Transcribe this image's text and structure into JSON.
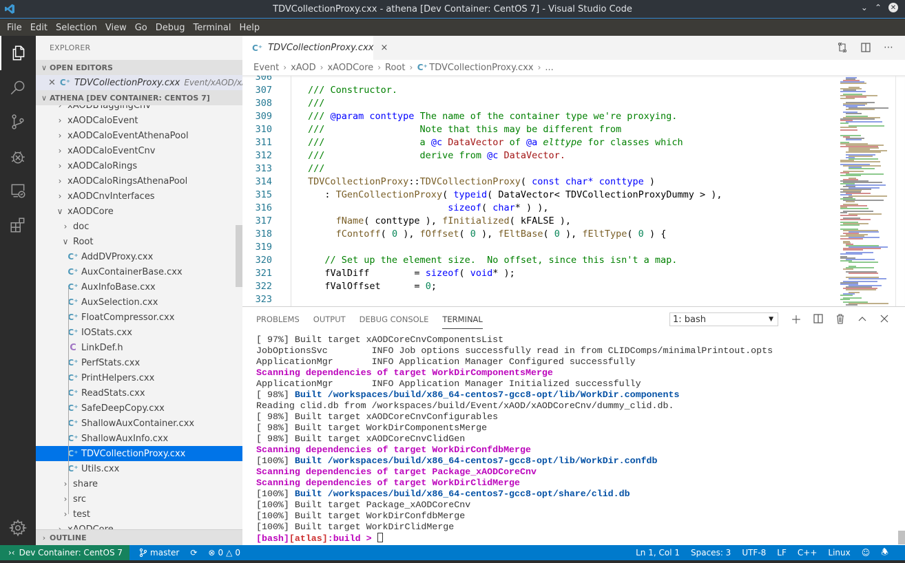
{
  "window": {
    "title": "TDVCollectionProxy.cxx - athena [Dev Container: CentOS 7] - Visual Studio Code",
    "controls": [
      "minimize",
      "maximize",
      "close"
    ]
  },
  "menu": [
    "File",
    "Edit",
    "Selection",
    "View",
    "Go",
    "Debug",
    "Terminal",
    "Help"
  ],
  "activity_bar": [
    {
      "icon": "files-icon",
      "active": true
    },
    {
      "icon": "search-icon"
    },
    {
      "icon": "source-control-icon"
    },
    {
      "icon": "debug-icon"
    },
    {
      "icon": "remote-explorer-icon"
    },
    {
      "icon": "extensions-icon"
    },
    {
      "icon": "gear-icon"
    }
  ],
  "sidebar": {
    "title": "EXPLORER",
    "open_editors": {
      "label": "OPEN EDITORS",
      "items": [
        {
          "name": "TDVCollectionProxy.cxx",
          "path": "Event/xAOD/xAO..."
        }
      ]
    },
    "workspace_label": "ATHENA [DEV CONTAINER: CENTOS 7]",
    "tree": [
      {
        "label": "xAODBTaggingCnv",
        "type": "folder",
        "expanded": false,
        "depth": 1
      },
      {
        "label": "xAODCaloEvent",
        "type": "folder",
        "expanded": false,
        "depth": 1
      },
      {
        "label": "xAODCaloEventAthenaPool",
        "type": "folder",
        "expanded": false,
        "depth": 1
      },
      {
        "label": "xAODCaloEventCnv",
        "type": "folder",
        "expanded": false,
        "depth": 1
      },
      {
        "label": "xAODCaloRings",
        "type": "folder",
        "expanded": false,
        "depth": 1
      },
      {
        "label": "xAODCaloRingsAthenaPool",
        "type": "folder",
        "expanded": false,
        "depth": 1
      },
      {
        "label": "xAODCnvInterfaces",
        "type": "folder",
        "expanded": false,
        "depth": 1
      },
      {
        "label": "xAODCore",
        "type": "folder",
        "expanded": true,
        "depth": 1
      },
      {
        "label": "doc",
        "type": "folder",
        "expanded": false,
        "depth": 2
      },
      {
        "label": "Root",
        "type": "folder",
        "expanded": true,
        "depth": 2
      },
      {
        "label": "AddDVProxy.cxx",
        "type": "cpp",
        "depth": 3
      },
      {
        "label": "AuxContainerBase.cxx",
        "type": "cpp",
        "depth": 3
      },
      {
        "label": "AuxInfoBase.cxx",
        "type": "cpp",
        "depth": 3
      },
      {
        "label": "AuxSelection.cxx",
        "type": "cpp",
        "depth": 3
      },
      {
        "label": "FloatCompressor.cxx",
        "type": "cpp",
        "depth": 3
      },
      {
        "label": "IOStats.cxx",
        "type": "cpp",
        "depth": 3
      },
      {
        "label": "LinkDef.h",
        "type": "h",
        "depth": 3
      },
      {
        "label": "PerfStats.cxx",
        "type": "cpp",
        "depth": 3
      },
      {
        "label": "PrintHelpers.cxx",
        "type": "cpp",
        "depth": 3
      },
      {
        "label": "ReadStats.cxx",
        "type": "cpp",
        "depth": 3
      },
      {
        "label": "SafeDeepCopy.cxx",
        "type": "cpp",
        "depth": 3
      },
      {
        "label": "ShallowAuxContainer.cxx",
        "type": "cpp",
        "depth": 3
      },
      {
        "label": "ShallowAuxInfo.cxx",
        "type": "cpp",
        "depth": 3
      },
      {
        "label": "TDVCollectionProxy.cxx",
        "type": "cpp",
        "depth": 3,
        "selected": true
      },
      {
        "label": "Utils.cxx",
        "type": "cpp",
        "depth": 3
      },
      {
        "label": "share",
        "type": "folder",
        "expanded": false,
        "depth": 2
      },
      {
        "label": "src",
        "type": "folder",
        "expanded": false,
        "depth": 2
      },
      {
        "label": "test",
        "type": "folder",
        "expanded": false,
        "depth": 2
      },
      {
        "label": "xAODCore",
        "type": "folder",
        "expanded": false,
        "depth": 1
      }
    ],
    "outline_label": "OUTLINE"
  },
  "editor": {
    "tab": {
      "name": "TDVCollectionProxy.cxx",
      "close": "×"
    },
    "breadcrumb": [
      "Event",
      "xAOD",
      "xAODCore",
      "Root",
      "TDVCollectionProxy.cxx",
      "..."
    ],
    "lines": [
      {
        "n": "306",
        "tokens": []
      },
      {
        "n": "307",
        "tokens": [
          {
            "t": "/// Constructor.",
            "c": "c-com"
          }
        ]
      },
      {
        "n": "308",
        "tokens": [
          {
            "t": "///",
            "c": "c-com"
          }
        ]
      },
      {
        "n": "309",
        "tokens": [
          {
            "t": "/// ",
            "c": "c-com"
          },
          {
            "t": "@param conttype",
            "c": "c-doc"
          },
          {
            "t": " The name of the container type we're proxying.",
            "c": "c-com"
          }
        ]
      },
      {
        "n": "310",
        "tokens": [
          {
            "t": "///                 Note that this may be different from",
            "c": "c-com"
          }
        ]
      },
      {
        "n": "311",
        "tokens": [
          {
            "t": "///                 a ",
            "c": "c-com"
          },
          {
            "t": "@c",
            "c": "c-doc"
          },
          {
            "t": " DataVector",
            "c": "c-type"
          },
          {
            "t": " of ",
            "c": "c-com"
          },
          {
            "t": "@a",
            "c": "c-doc"
          },
          {
            "t": " elttype",
            "c": "c-com c-it"
          },
          {
            "t": " for classes which",
            "c": "c-com"
          }
        ]
      },
      {
        "n": "312",
        "tokens": [
          {
            "t": "///                 derive from ",
            "c": "c-com"
          },
          {
            "t": "@c",
            "c": "c-doc"
          },
          {
            "t": " DataVector.",
            "c": "c-type"
          }
        ]
      },
      {
        "n": "313",
        "tokens": [
          {
            "t": "///",
            "c": "c-com"
          }
        ]
      },
      {
        "n": "314",
        "tokens": [
          {
            "t": "TDVCollectionProxy",
            "c": "c-fn"
          },
          {
            "t": "::",
            "c": ""
          },
          {
            "t": "TDVCollectionProxy",
            "c": "c-fn"
          },
          {
            "t": "( ",
            "c": ""
          },
          {
            "t": "const char*",
            "c": "c-kw"
          },
          {
            "t": " ",
            "c": ""
          },
          {
            "t": "conttype",
            "c": "c-kw"
          },
          {
            "t": " )",
            "c": ""
          }
        ]
      },
      {
        "n": "315",
        "tokens": [
          {
            "t": "   : ",
            "c": ""
          },
          {
            "t": "TGenCollectionProxy",
            "c": "c-fn"
          },
          {
            "t": "( ",
            "c": ""
          },
          {
            "t": "typeid",
            "c": "c-kw"
          },
          {
            "t": "( DataVector< TDVCollectionProxyDummy > ),",
            "c": ""
          }
        ]
      },
      {
        "n": "316",
        "tokens": [
          {
            "t": "                         ",
            "c": ""
          },
          {
            "t": "sizeof",
            "c": "c-kw"
          },
          {
            "t": "( ",
            "c": ""
          },
          {
            "t": "char",
            "c": "c-kw"
          },
          {
            "t": "* ) ),",
            "c": ""
          }
        ]
      },
      {
        "n": "317",
        "tokens": [
          {
            "t": "     ",
            "c": ""
          },
          {
            "t": "fName",
            "c": "c-fn"
          },
          {
            "t": "( conttype ), ",
            "c": ""
          },
          {
            "t": "fInitialized",
            "c": "c-fn"
          },
          {
            "t": "( kFALSE ),",
            "c": ""
          }
        ]
      },
      {
        "n": "318",
        "tokens": [
          {
            "t": "     ",
            "c": ""
          },
          {
            "t": "fContoff",
            "c": "c-fn"
          },
          {
            "t": "( ",
            "c": ""
          },
          {
            "t": "0",
            "c": "c-num"
          },
          {
            "t": " ), ",
            "c": ""
          },
          {
            "t": "fOffset",
            "c": "c-fn"
          },
          {
            "t": "( ",
            "c": ""
          },
          {
            "t": "0",
            "c": "c-num"
          },
          {
            "t": " ), ",
            "c": ""
          },
          {
            "t": "fEltBase",
            "c": "c-fn"
          },
          {
            "t": "( ",
            "c": ""
          },
          {
            "t": "0",
            "c": "c-num"
          },
          {
            "t": " ), ",
            "c": ""
          },
          {
            "t": "fEltType",
            "c": "c-fn"
          },
          {
            "t": "( ",
            "c": ""
          },
          {
            "t": "0",
            "c": "c-num"
          },
          {
            "t": " ) {",
            "c": ""
          }
        ]
      },
      {
        "n": "319",
        "tokens": []
      },
      {
        "n": "320",
        "tokens": [
          {
            "t": "   // Set up the element size.  No offset, since this isn't a map.",
            "c": "c-com"
          }
        ]
      },
      {
        "n": "321",
        "tokens": [
          {
            "t": "   fValDiff        = ",
            "c": ""
          },
          {
            "t": "sizeof",
            "c": "c-kw"
          },
          {
            "t": "( ",
            "c": ""
          },
          {
            "t": "void",
            "c": "c-kw"
          },
          {
            "t": "* );",
            "c": ""
          }
        ]
      },
      {
        "n": "322",
        "tokens": [
          {
            "t": "   fValOffset      = ",
            "c": ""
          },
          {
            "t": "0",
            "c": "c-num"
          },
          {
            "t": ";",
            "c": ""
          }
        ]
      },
      {
        "n": "323",
        "tokens": []
      }
    ]
  },
  "panel": {
    "tabs": [
      {
        "label": "PROBLEMS"
      },
      {
        "label": "OUTPUT"
      },
      {
        "label": "DEBUG CONSOLE"
      },
      {
        "label": "TERMINAL",
        "active": true
      }
    ],
    "terminal_select": "1: bash",
    "actions": [
      "new-terminal",
      "split-terminal",
      "kill-terminal",
      "maximize-panel",
      "close-panel"
    ],
    "terminal_lines": [
      [
        {
          "t": "[ 97%] Built target xAODCoreCnvComponentsList",
          "c": ""
        }
      ],
      [
        {
          "t": "JobOptionsSvc        INFO Job options successfully read in from CLIDComps/minimalPrintout.opts",
          "c": ""
        }
      ],
      [
        {
          "t": "ApplicationMgr       INFO Application Manager Configured successfully",
          "c": ""
        }
      ],
      [
        {
          "t": "Scanning dependencies of target WorkDirComponentsMerge",
          "c": "t-mag"
        }
      ],
      [
        {
          "t": "ApplicationMgr       INFO Application Manager Initialized successfully",
          "c": ""
        }
      ],
      [
        {
          "t": "[ 98%] ",
          "c": ""
        },
        {
          "t": "Built /workspaces/build/x86_64-centos7-gcc8-opt/lib/WorkDir.components",
          "c": "t-blue"
        }
      ],
      [
        {
          "t": "Reading clid.db from /workspaces/build/Event/xAOD/xAODCoreCnv/dummy_clid.db.",
          "c": ""
        }
      ],
      [
        {
          "t": "[ 98%] Built target xAODCoreCnvConfigurables",
          "c": ""
        }
      ],
      [
        {
          "t": "[ 98%] Built target WorkDirComponentsMerge",
          "c": ""
        }
      ],
      [
        {
          "t": "[ 98%] Built target xAODCoreCnvClidGen",
          "c": ""
        }
      ],
      [
        {
          "t": "Scanning dependencies of target WorkDirConfdbMerge",
          "c": "t-mag"
        }
      ],
      [
        {
          "t": "[100%] ",
          "c": ""
        },
        {
          "t": "Built /workspaces/build/x86_64-centos7-gcc8-opt/lib/WorkDir.confdb",
          "c": "t-blue"
        }
      ],
      [
        {
          "t": "Scanning dependencies of target Package_xAODCoreCnv",
          "c": "t-mag"
        }
      ],
      [
        {
          "t": "Scanning dependencies of target WorkDirClidMerge",
          "c": "t-mag"
        }
      ],
      [
        {
          "t": "[100%] ",
          "c": ""
        },
        {
          "t": "Built /workspaces/build/x86_64-centos7-gcc8-opt/share/clid.db",
          "c": "t-blue"
        }
      ],
      [
        {
          "t": "[100%] Built target Package_xAODCoreCnv",
          "c": ""
        }
      ],
      [
        {
          "t": "[100%] Built target WorkDirConfdbMerge",
          "c": ""
        }
      ],
      [
        {
          "t": "[100%] Built target WorkDirClidMerge",
          "c": ""
        }
      ]
    ],
    "prompt": [
      {
        "t": "[bash]",
        "c": "t-mag"
      },
      {
        "t": "[atlas]",
        "c": "t-red"
      },
      {
        "t": ":build > ",
        "c": "t-mag"
      }
    ]
  },
  "statusbar": {
    "remote": "Dev Container: CentOS 7",
    "branch": "master",
    "errors": "0",
    "warnings": "0",
    "position": "Ln 1, Col 1",
    "indent": "Spaces: 3",
    "encoding": "UTF-8",
    "eol": "LF",
    "language": "C++",
    "os": "Linux"
  },
  "colors": {
    "accent": "#007acc",
    "remote": "#16825d",
    "selection": "#0074e8"
  }
}
